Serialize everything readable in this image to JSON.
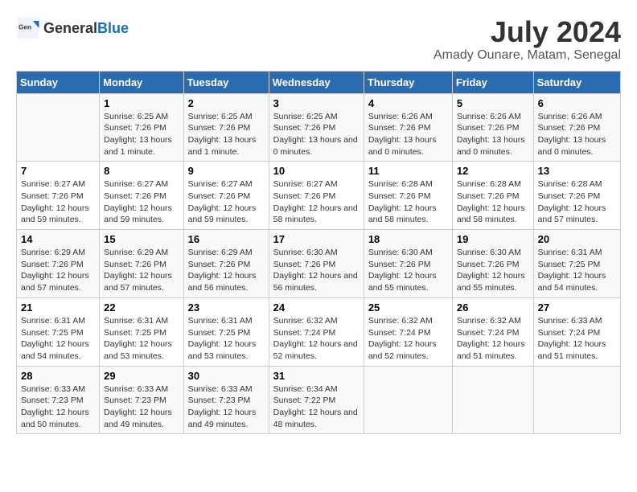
{
  "header": {
    "logo_general": "General",
    "logo_blue": "Blue",
    "title": "July 2024",
    "subtitle": "Amady Ounare, Matam, Senegal"
  },
  "days_of_week": [
    "Sunday",
    "Monday",
    "Tuesday",
    "Wednesday",
    "Thursday",
    "Friday",
    "Saturday"
  ],
  "weeks": [
    [
      {
        "date": "",
        "sunrise": "",
        "sunset": "",
        "daylight": ""
      },
      {
        "date": "1",
        "sunrise": "Sunrise: 6:25 AM",
        "sunset": "Sunset: 7:26 PM",
        "daylight": "Daylight: 13 hours and 1 minute."
      },
      {
        "date": "2",
        "sunrise": "Sunrise: 6:25 AM",
        "sunset": "Sunset: 7:26 PM",
        "daylight": "Daylight: 13 hours and 1 minute."
      },
      {
        "date": "3",
        "sunrise": "Sunrise: 6:25 AM",
        "sunset": "Sunset: 7:26 PM",
        "daylight": "Daylight: 13 hours and 0 minutes."
      },
      {
        "date": "4",
        "sunrise": "Sunrise: 6:26 AM",
        "sunset": "Sunset: 7:26 PM",
        "daylight": "Daylight: 13 hours and 0 minutes."
      },
      {
        "date": "5",
        "sunrise": "Sunrise: 6:26 AM",
        "sunset": "Sunset: 7:26 PM",
        "daylight": "Daylight: 13 hours and 0 minutes."
      },
      {
        "date": "6",
        "sunrise": "Sunrise: 6:26 AM",
        "sunset": "Sunset: 7:26 PM",
        "daylight": "Daylight: 13 hours and 0 minutes."
      }
    ],
    [
      {
        "date": "7",
        "sunrise": "Sunrise: 6:27 AM",
        "sunset": "Sunset: 7:26 PM",
        "daylight": "Daylight: 12 hours and 59 minutes."
      },
      {
        "date": "8",
        "sunrise": "Sunrise: 6:27 AM",
        "sunset": "Sunset: 7:26 PM",
        "daylight": "Daylight: 12 hours and 59 minutes."
      },
      {
        "date": "9",
        "sunrise": "Sunrise: 6:27 AM",
        "sunset": "Sunset: 7:26 PM",
        "daylight": "Daylight: 12 hours and 59 minutes."
      },
      {
        "date": "10",
        "sunrise": "Sunrise: 6:27 AM",
        "sunset": "Sunset: 7:26 PM",
        "daylight": "Daylight: 12 hours and 58 minutes."
      },
      {
        "date": "11",
        "sunrise": "Sunrise: 6:28 AM",
        "sunset": "Sunset: 7:26 PM",
        "daylight": "Daylight: 12 hours and 58 minutes."
      },
      {
        "date": "12",
        "sunrise": "Sunrise: 6:28 AM",
        "sunset": "Sunset: 7:26 PM",
        "daylight": "Daylight: 12 hours and 58 minutes."
      },
      {
        "date": "13",
        "sunrise": "Sunrise: 6:28 AM",
        "sunset": "Sunset: 7:26 PM",
        "daylight": "Daylight: 12 hours and 57 minutes."
      }
    ],
    [
      {
        "date": "14",
        "sunrise": "Sunrise: 6:29 AM",
        "sunset": "Sunset: 7:26 PM",
        "daylight": "Daylight: 12 hours and 57 minutes."
      },
      {
        "date": "15",
        "sunrise": "Sunrise: 6:29 AM",
        "sunset": "Sunset: 7:26 PM",
        "daylight": "Daylight: 12 hours and 57 minutes."
      },
      {
        "date": "16",
        "sunrise": "Sunrise: 6:29 AM",
        "sunset": "Sunset: 7:26 PM",
        "daylight": "Daylight: 12 hours and 56 minutes."
      },
      {
        "date": "17",
        "sunrise": "Sunrise: 6:30 AM",
        "sunset": "Sunset: 7:26 PM",
        "daylight": "Daylight: 12 hours and 56 minutes."
      },
      {
        "date": "18",
        "sunrise": "Sunrise: 6:30 AM",
        "sunset": "Sunset: 7:26 PM",
        "daylight": "Daylight: 12 hours and 55 minutes."
      },
      {
        "date": "19",
        "sunrise": "Sunrise: 6:30 AM",
        "sunset": "Sunset: 7:26 PM",
        "daylight": "Daylight: 12 hours and 55 minutes."
      },
      {
        "date": "20",
        "sunrise": "Sunrise: 6:31 AM",
        "sunset": "Sunset: 7:25 PM",
        "daylight": "Daylight: 12 hours and 54 minutes."
      }
    ],
    [
      {
        "date": "21",
        "sunrise": "Sunrise: 6:31 AM",
        "sunset": "Sunset: 7:25 PM",
        "daylight": "Daylight: 12 hours and 54 minutes."
      },
      {
        "date": "22",
        "sunrise": "Sunrise: 6:31 AM",
        "sunset": "Sunset: 7:25 PM",
        "daylight": "Daylight: 12 hours and 53 minutes."
      },
      {
        "date": "23",
        "sunrise": "Sunrise: 6:31 AM",
        "sunset": "Sunset: 7:25 PM",
        "daylight": "Daylight: 12 hours and 53 minutes."
      },
      {
        "date": "24",
        "sunrise": "Sunrise: 6:32 AM",
        "sunset": "Sunset: 7:24 PM",
        "daylight": "Daylight: 12 hours and 52 minutes."
      },
      {
        "date": "25",
        "sunrise": "Sunrise: 6:32 AM",
        "sunset": "Sunset: 7:24 PM",
        "daylight": "Daylight: 12 hours and 52 minutes."
      },
      {
        "date": "26",
        "sunrise": "Sunrise: 6:32 AM",
        "sunset": "Sunset: 7:24 PM",
        "daylight": "Daylight: 12 hours and 51 minutes."
      },
      {
        "date": "27",
        "sunrise": "Sunrise: 6:33 AM",
        "sunset": "Sunset: 7:24 PM",
        "daylight": "Daylight: 12 hours and 51 minutes."
      }
    ],
    [
      {
        "date": "28",
        "sunrise": "Sunrise: 6:33 AM",
        "sunset": "Sunset: 7:23 PM",
        "daylight": "Daylight: 12 hours and 50 minutes."
      },
      {
        "date": "29",
        "sunrise": "Sunrise: 6:33 AM",
        "sunset": "Sunset: 7:23 PM",
        "daylight": "Daylight: 12 hours and 49 minutes."
      },
      {
        "date": "30",
        "sunrise": "Sunrise: 6:33 AM",
        "sunset": "Sunset: 7:23 PM",
        "daylight": "Daylight: 12 hours and 49 minutes."
      },
      {
        "date": "31",
        "sunrise": "Sunrise: 6:34 AM",
        "sunset": "Sunset: 7:22 PM",
        "daylight": "Daylight: 12 hours and 48 minutes."
      },
      {
        "date": "",
        "sunrise": "",
        "sunset": "",
        "daylight": ""
      },
      {
        "date": "",
        "sunrise": "",
        "sunset": "",
        "daylight": ""
      },
      {
        "date": "",
        "sunrise": "",
        "sunset": "",
        "daylight": ""
      }
    ]
  ]
}
